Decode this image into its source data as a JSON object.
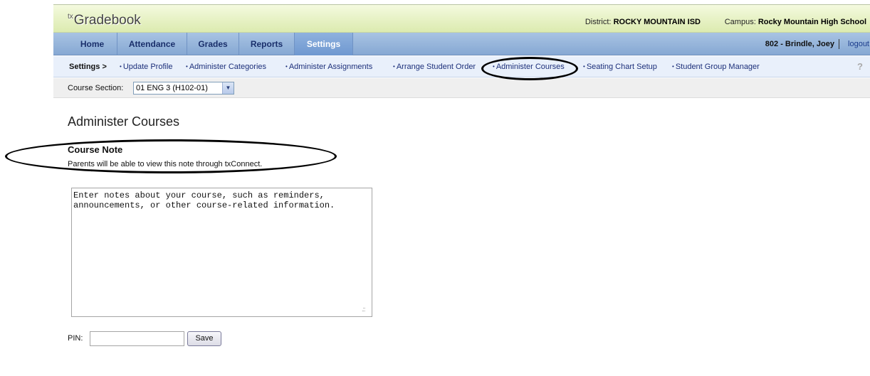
{
  "app": {
    "logo_prefix": "tx",
    "logo_name": "Gradebook"
  },
  "header": {
    "district_label": "District:",
    "district_value": "ROCKY MOUNTAIN ISD",
    "campus_label": "Campus:",
    "campus_value": "Rocky Mountain High School"
  },
  "nav": {
    "items": [
      "Home",
      "Attendance",
      "Grades",
      "Reports",
      "Settings"
    ],
    "active": "Settings",
    "user": "802 - Brindle, Joey",
    "logout": "logout"
  },
  "subnav": {
    "label": "Settings >",
    "links": [
      "Update Profile",
      "Administer Categories",
      "Administer Assignments",
      "Arrange Student Order",
      "Administer Courses",
      "Seating Chart Setup",
      "Student Group Manager"
    ],
    "help_icon": "question-icon"
  },
  "section": {
    "label": "Course Section:",
    "selected": "01 ENG 3 (H102-01)"
  },
  "page": {
    "title": "Administer Courses"
  },
  "note": {
    "title": "Course Note",
    "description": "Parents will be able to view this note through txConnect.",
    "value": "Enter notes about your course, such as reminders,\nannouncements, or other course-related information."
  },
  "pin": {
    "label": "PIN:",
    "value": "",
    "save_label": "Save"
  }
}
